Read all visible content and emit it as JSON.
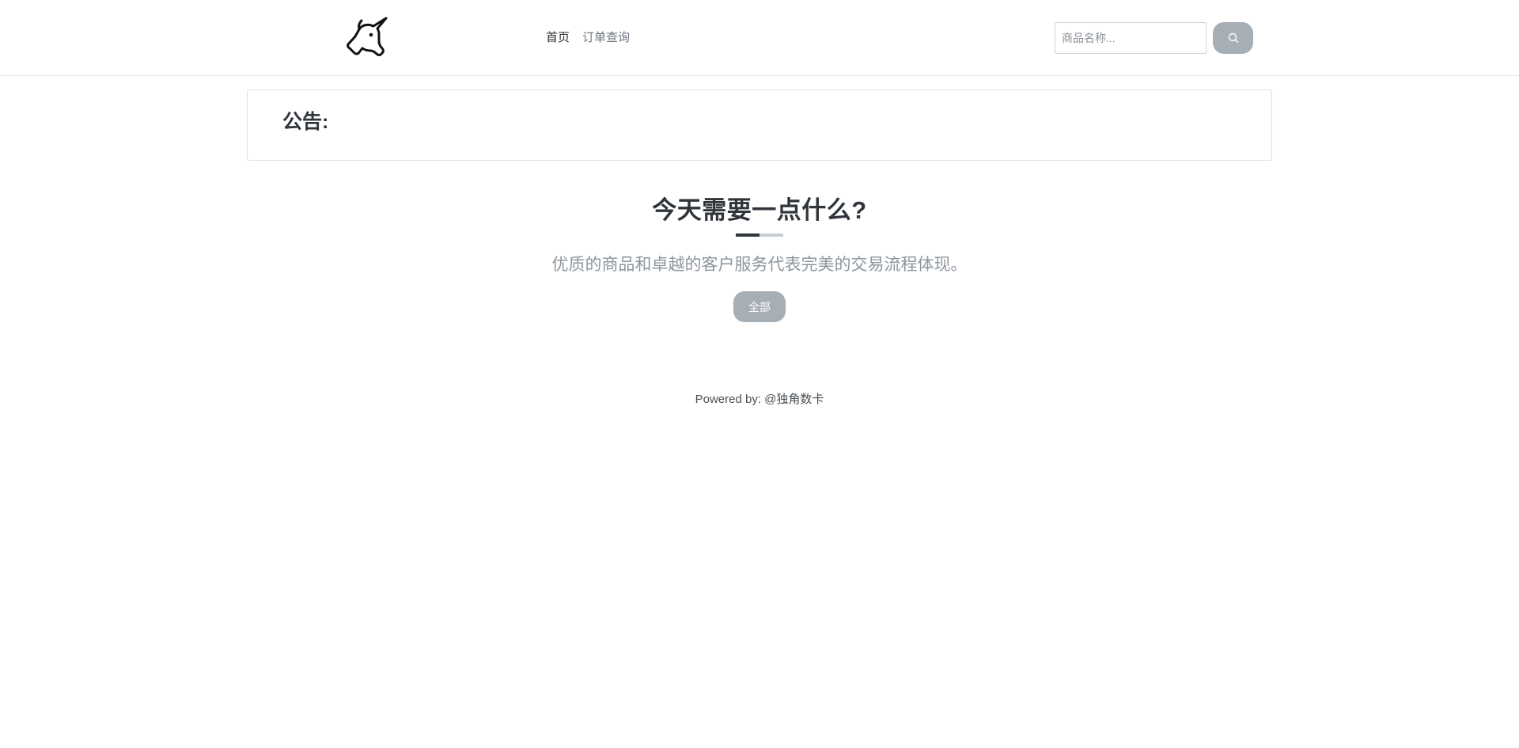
{
  "header": {
    "logo_icon": "unicorn-icon",
    "nav": [
      {
        "label": "首页",
        "active": true
      },
      {
        "label": "订单查询",
        "active": false
      }
    ],
    "search": {
      "placeholder": "商品名称...",
      "value": "",
      "button_icon": "search-icon"
    }
  },
  "notice": {
    "title": "公告:"
  },
  "hero": {
    "title": "今天需要一点什么?",
    "subtitle": "优质的商品和卓越的客户服务代表完美的交易流程体现。",
    "category_button": "全部"
  },
  "footer": {
    "text": "Powered by: @独角数卡"
  },
  "colors": {
    "button_gray": "#a6aeb6",
    "heading_dark": "#2f353a",
    "subtitle_gray": "#8d959d",
    "border": "#dee2e6"
  }
}
